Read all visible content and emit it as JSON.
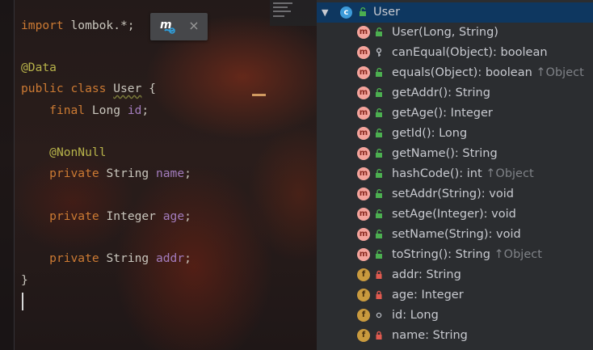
{
  "editor": {
    "lines": [
      {
        "parts": [
          {
            "t": "import",
            "c": "kw"
          },
          {
            "t": " lombok.*;",
            "c": ""
          }
        ]
      },
      {
        "parts": [
          {
            "t": "@Data",
            "c": "ann"
          }
        ]
      },
      {
        "parts": [
          {
            "t": "public class ",
            "c": "kw"
          },
          {
            "t": "User",
            "c": "cls"
          },
          {
            "t": " {",
            "c": ""
          }
        ]
      },
      {
        "parts": [
          {
            "t": "    ",
            "c": ""
          },
          {
            "t": "final",
            "c": "kw"
          },
          {
            "t": " Long ",
            "c": ""
          },
          {
            "t": "id",
            "c": "field"
          },
          {
            "t": ";",
            "c": ""
          }
        ]
      },
      {
        "parts": [
          {
            "t": "    ",
            "c": ""
          },
          {
            "t": "@NonNull",
            "c": "ann"
          }
        ]
      },
      {
        "parts": [
          {
            "t": "    ",
            "c": ""
          },
          {
            "t": "private",
            "c": "kw"
          },
          {
            "t": " String ",
            "c": ""
          },
          {
            "t": "name",
            "c": "field"
          },
          {
            "t": ";",
            "c": ""
          }
        ]
      },
      {
        "parts": [
          {
            "t": "    ",
            "c": ""
          },
          {
            "t": "private",
            "c": "kw"
          },
          {
            "t": " Integer ",
            "c": ""
          },
          {
            "t": "age",
            "c": "field"
          },
          {
            "t": ";",
            "c": ""
          }
        ]
      },
      {
        "parts": [
          {
            "t": "    ",
            "c": ""
          },
          {
            "t": "private",
            "c": "kw"
          },
          {
            "t": " String ",
            "c": ""
          },
          {
            "t": "addr",
            "c": "field"
          },
          {
            "t": ";",
            "c": ""
          }
        ]
      },
      {
        "parts": [
          {
            "t": "}",
            "c": ""
          }
        ]
      }
    ],
    "tooltip": {
      "logo_letter": "m",
      "close_glyph": "×"
    }
  },
  "structure": {
    "class_name": "User",
    "class_icon_letter": "c",
    "expand_glyph": "▼",
    "members": [
      {
        "kind": "m",
        "vis": "public",
        "label": "User(Long, String)",
        "inherited": ""
      },
      {
        "kind": "m",
        "vis": "key",
        "label": "canEqual(Object): boolean",
        "inherited": ""
      },
      {
        "kind": "m",
        "vis": "public",
        "label": "equals(Object): boolean",
        "inherited": "↑Object"
      },
      {
        "kind": "m",
        "vis": "public",
        "label": "getAddr(): String",
        "inherited": ""
      },
      {
        "kind": "m",
        "vis": "public",
        "label": "getAge(): Integer",
        "inherited": ""
      },
      {
        "kind": "m",
        "vis": "public",
        "label": "getId(): Long",
        "inherited": ""
      },
      {
        "kind": "m",
        "vis": "public",
        "label": "getName(): String",
        "inherited": ""
      },
      {
        "kind": "m",
        "vis": "public",
        "label": "hashCode(): int",
        "inherited": "↑Object"
      },
      {
        "kind": "m",
        "vis": "public",
        "label": "setAddr(String): void",
        "inherited": ""
      },
      {
        "kind": "m",
        "vis": "public",
        "label": "setAge(Integer): void",
        "inherited": ""
      },
      {
        "kind": "m",
        "vis": "public",
        "label": "setName(String): void",
        "inherited": ""
      },
      {
        "kind": "m",
        "vis": "public",
        "label": "toString(): String",
        "inherited": "↑Object"
      },
      {
        "kind": "f",
        "vis": "private",
        "label": "addr: String",
        "inherited": ""
      },
      {
        "kind": "f",
        "vis": "private",
        "label": "age: Integer",
        "inherited": ""
      },
      {
        "kind": "f",
        "vis": "package",
        "label": "id: Long",
        "inherited": ""
      },
      {
        "kind": "f",
        "vis": "private",
        "label": "name: String",
        "inherited": ""
      }
    ]
  },
  "colors": {
    "keyword": "#cc7a33",
    "annotation": "#b8b34a",
    "field": "#a37cbd",
    "method_icon": "#f4a49c",
    "field_icon": "#c99a3e",
    "class_icon": "#3d9bd9",
    "public_lock": "#4caf50",
    "private_lock": "#e05a4f",
    "selection": "#0e3760"
  }
}
